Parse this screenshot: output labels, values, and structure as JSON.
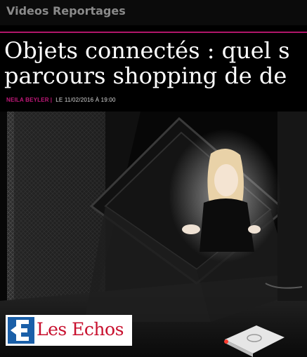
{
  "section": {
    "label": "Videos Reportages"
  },
  "article": {
    "title_line1": "Objets connectés : quel s",
    "title_line2": "parcours shopping de de",
    "author": "NEILA BEYLER",
    "separator": "|",
    "date": "LE 11/02/2016 À 19:00"
  },
  "video": {
    "logo": {
      "text": "Les Echos",
      "icon": "les-echos-logo-icon"
    }
  },
  "colors": {
    "accent": "#b0166a",
    "logo_red": "#c8102e",
    "logo_blue": "#1a5fa8"
  }
}
